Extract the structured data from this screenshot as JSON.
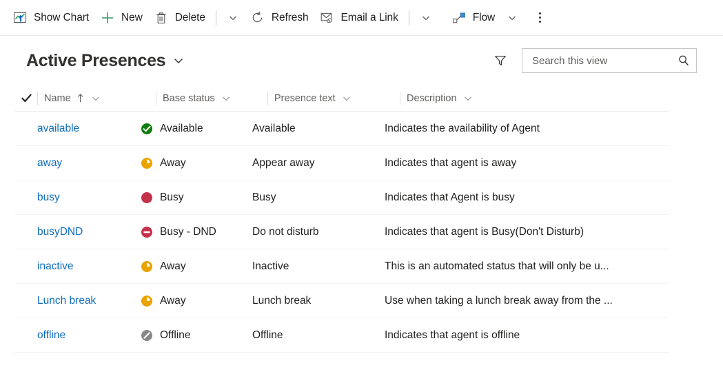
{
  "commandbar": {
    "buttons": [
      {
        "id": "show-chart",
        "label": "Show Chart",
        "icon": "chart-icon"
      },
      {
        "id": "new",
        "label": "New",
        "icon": "plus-icon"
      },
      {
        "id": "delete",
        "label": "Delete",
        "icon": "trash-icon"
      },
      {
        "id": "refresh",
        "label": "Refresh",
        "icon": "refresh-icon"
      },
      {
        "id": "email-a-link",
        "label": "Email a Link",
        "icon": "email-icon"
      },
      {
        "id": "flow",
        "label": "Flow",
        "icon": "flow-icon"
      }
    ],
    "overflow_label": "More commands"
  },
  "viewbar": {
    "title": "Active Presences",
    "title_caret": "chevron-down-icon",
    "filter_icon": "filter-icon",
    "search": {
      "placeholder": "Search this view",
      "value": "",
      "icon": "search-icon"
    }
  },
  "grid": {
    "select_all_icon": "checkmark-icon",
    "columns": [
      {
        "key": "name",
        "label": "Name",
        "sorted": "ascending",
        "sort_icon": "arrow-up-icon"
      },
      {
        "key": "base_status",
        "label": "Base status"
      },
      {
        "key": "presence_text",
        "label": "Presence text"
      },
      {
        "key": "description",
        "label": "Description"
      }
    ],
    "rows": [
      {
        "name": "available",
        "base_status": "Available",
        "status_icon": "available-icon",
        "status_color": "#107c10",
        "presence_text": "Available",
        "description": "Indicates the availability of Agent"
      },
      {
        "name": "away",
        "base_status": "Away",
        "status_icon": "away-clock-icon",
        "status_color": "#eaa300",
        "presence_text": "Appear away",
        "description": "Indicates that agent is away"
      },
      {
        "name": "busy",
        "base_status": "Busy",
        "status_icon": "busy-icon",
        "status_color": "#c4314b",
        "presence_text": "Busy",
        "description": "Indicates that Agent is busy"
      },
      {
        "name": "busyDND",
        "base_status": "Busy - DND",
        "status_icon": "dnd-icon",
        "status_color": "#c4314b",
        "presence_text": "Do not disturb",
        "description": "Indicates that agent is Busy(Don't Disturb)"
      },
      {
        "name": "inactive",
        "base_status": "Away",
        "status_icon": "away-clock-icon",
        "status_color": "#eaa300",
        "presence_text": "Inactive",
        "description": "This is an automated status that will only be u..."
      },
      {
        "name": "Lunch break",
        "base_status": "Away",
        "status_icon": "away-clock-icon",
        "status_color": "#eaa300",
        "presence_text": "Lunch break",
        "description": "Use when taking a lunch break away from the ..."
      },
      {
        "name": "offline",
        "base_status": "Offline",
        "status_icon": "offline-icon",
        "status_color": "#8a8886",
        "presence_text": "Offline",
        "description": "Indicates that agent is offline"
      }
    ]
  }
}
